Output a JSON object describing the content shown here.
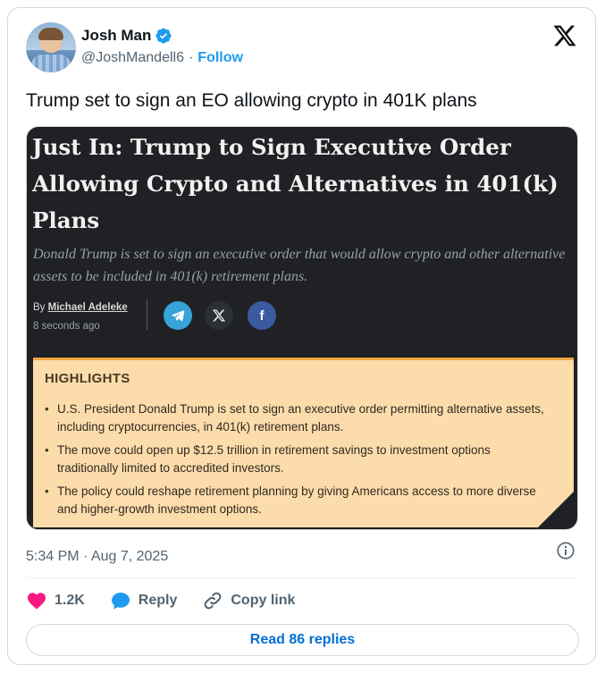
{
  "author": {
    "name": "Josh Man",
    "handle": "@JoshMandell6",
    "separator": "·",
    "follow_label": "Follow"
  },
  "tweet_text": "Trump set to sign an EO allowing crypto in 401K plans",
  "article": {
    "headline": "Just In: Trump to Sign Executive Order Allowing Crypto and Alternatives in 401(k) Plans",
    "subhead": "Donald Trump is set to sign an executive order that would allow crypto and other alternative assets to be included in 401(k) retirement plans.",
    "by_prefix": "By",
    "author": "Michael Adeleke",
    "time_ago": "8 seconds ago",
    "share_facebook_glyph": "f",
    "highlights_title": "HIGHLIGHTS",
    "highlights": [
      "U.S. President Donald Trump is set to sign an executive order permitting alternative assets, including cryptocurrencies, in 401(k) retirement plans.",
      "The move could open up $12.5 trillion in retirement savings to investment options traditionally limited to accredited investors.",
      "The policy could reshape retirement planning by giving Americans access to more diverse and higher-growth investment options."
    ]
  },
  "timestamp": "5:34 PM · Aug 7, 2025",
  "actions": {
    "likes": "1.2K",
    "reply_label": "Reply",
    "copy_link_label": "Copy link"
  },
  "read_replies_label": "Read 86 replies",
  "colors": {
    "accent": "#1d9bf0",
    "like": "#f91880",
    "highlight_bg": "#fddcab",
    "media_bg": "#1f2124"
  },
  "icons": [
    "verified-badge-icon",
    "x-logo-icon",
    "telegram-icon",
    "x-share-icon",
    "facebook-icon",
    "info-icon",
    "heart-icon",
    "reply-bubble-icon",
    "link-icon"
  ]
}
